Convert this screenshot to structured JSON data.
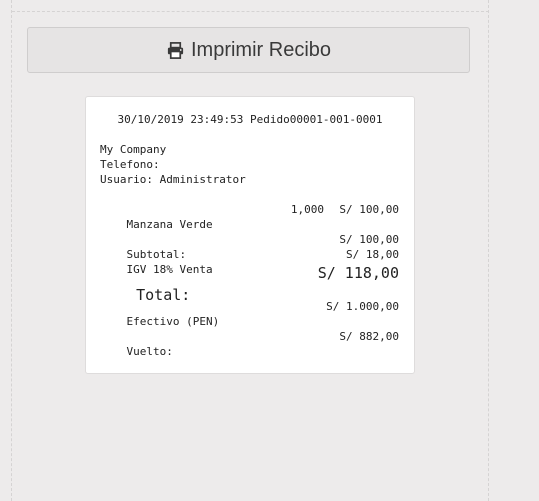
{
  "toolbar": {
    "print_label": "Imprimir Recibo",
    "print_icon": "printer-icon"
  },
  "receipt": {
    "header": "30/10/2019 23:49:53 Pedido00001-001-0001",
    "company": "My Company",
    "phone_label": "Telefono:",
    "user_label": "Usuario: Administrator",
    "item": {
      "name": "Manzana Verde",
      "quantity": "1,000",
      "amount": "S/ 100,00"
    },
    "subtotal_label": "Subtotal:",
    "subtotal_value": "S/ 100,00",
    "tax_label": "IGV 18% Venta",
    "tax_value": "S/ 18,00",
    "total_label": "Total:",
    "total_value": "S/ 118,00",
    "payment_label": "Efectivo (PEN)",
    "payment_value": "S/ 1.000,00",
    "change_label": "Vuelto:",
    "change_value": "S/ 882,00"
  }
}
